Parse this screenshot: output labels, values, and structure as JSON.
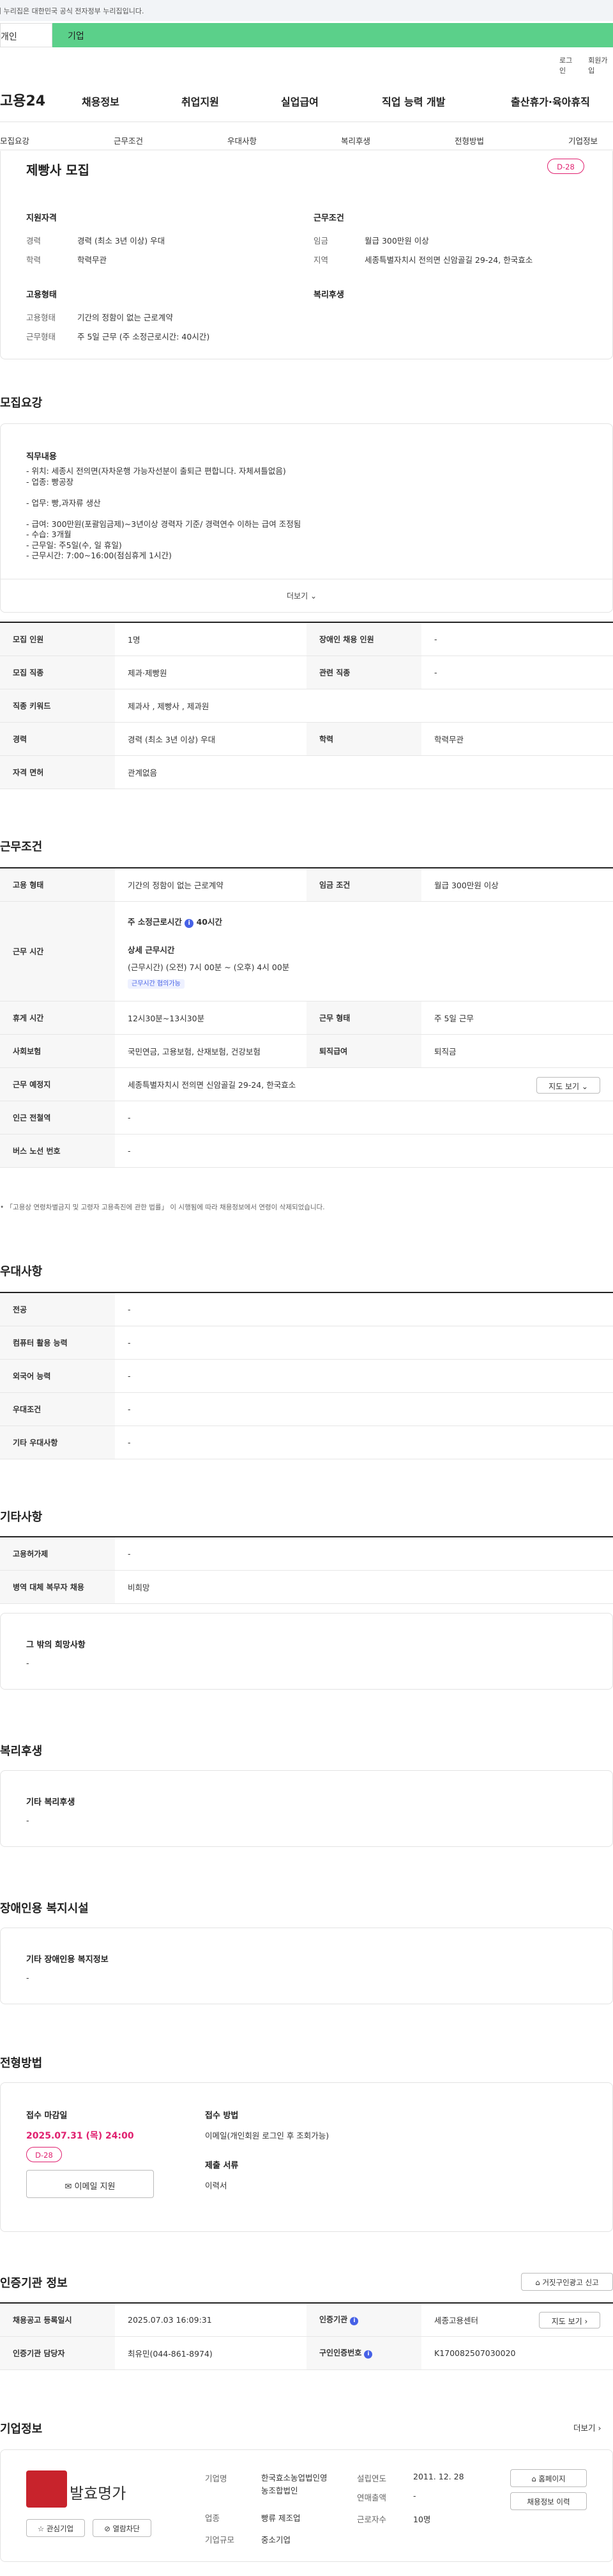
{
  "gov_banner": "이 누리집은 대한민국 공식 전자정부 누리집입니다.",
  "tabs": {
    "person": "개인",
    "corp": "기업"
  },
  "util": {
    "login": "로그인",
    "join": "회원가입"
  },
  "logo": "고용24",
  "gnb": [
    "채용정보",
    "취업지원",
    "실업급여",
    "직업 능력 개발",
    "출산휴가·육아휴직"
  ],
  "subnav": [
    "모집요강",
    "근무조건",
    "우대사항",
    "복리후생",
    "전형방법",
    "기업정보"
  ],
  "summary": {
    "title": "제빵사 모집",
    "dday": "D-28",
    "qual_title": "지원자격",
    "career_label": "경력",
    "career": "경력 (최소 3년 이상) 우대",
    "edu_label": "학력",
    "edu": "학력무관",
    "cond_title": "근무조건",
    "wage_label": "임금",
    "wage": "월급 300만원 이상",
    "region_label": "지역",
    "region": "세종특별자치시 전의면 신암골길 29-24, 한국효소",
    "emp_title": "고용형태",
    "emp_type_label": "고용형태",
    "emp_type": "기간의 정함이 없는 근로계약",
    "work_type_label": "근무형태",
    "work_type": "주 5일 근무 (주 소정근로시간: 40시간)",
    "welfare_title": "복리후생"
  },
  "recruit": {
    "heading": "모집요강",
    "job_title": "직무내용",
    "desc": [
      "- 위치: 세종시 전의면(자차운행 가능자선분이 출퇴근 편합니다. 자체셔틀없음)",
      "- 업종: 빵공장",
      "",
      "- 업무: 빵,과자류 생산",
      "",
      "- 급여: 300만원(포괄임금제)~3년이상 경력자 기준/ 경력연수 이하는 급여 조정됨",
      "- 수습: 3개월",
      "- 근무일: 주5일(수, 일 휴일)",
      "- 근무시간: 7:00~16:00(점심휴게 1시간)"
    ],
    "more": "더보기",
    "rows": [
      [
        "모집 인원",
        "1명",
        "장애인 채용 인원",
        "-"
      ],
      [
        "모집 직종",
        "제과·제빵원",
        "관련 직종",
        "-"
      ],
      [
        "직종 키워드",
        "제과사 , 제빵사 , 제과원",
        "",
        ""
      ],
      [
        "경력",
        "경력 (최소 3년 이상) 우대",
        "학력",
        "학력무관"
      ],
      [
        "자격 면허",
        "관계없음",
        "",
        ""
      ]
    ]
  },
  "work": {
    "heading": "근무조건",
    "r1": [
      "고용 형태",
      "기간의 정함이 없는 근로계약",
      "임금 조건",
      "월급 300만원 이상"
    ],
    "time_label": "근무 시간",
    "weekly": "주 소정근로시간",
    "weekly_val": "40시간",
    "detail_title": "상세 근무시간",
    "detail": "(근무시간) (오전) 7시 00분 ~ (오후) 4시 00분",
    "chip": "근무시간 협의가능",
    "r3": [
      "휴게 시간",
      "12시30분~13시30분",
      "근무 형태",
      "주 5일 근무"
    ],
    "r4": [
      "사회보험",
      "국민연금, 고용보험, 산재보험, 건강보험",
      "퇴직급여",
      "퇴직금"
    ],
    "place_label": "근무 예정지",
    "place": "세종특별자치시 전의면 신암골길 29-24, 한국효소",
    "map_btn": "지도 보기",
    "r6": [
      "인근 전철역",
      "-"
    ],
    "r7": [
      "버스 노선 번호",
      "-"
    ],
    "note": "「고용상 연령차별금지 및 고령자 고용촉진에 관한 법률」 이 시행됨에 따라 채용정보에서 연령이 삭제되었습니다."
  },
  "pref": {
    "heading": "우대사항",
    "rows": [
      [
        "전공",
        "-"
      ],
      [
        "컴퓨터 활용 능력",
        "-"
      ],
      [
        "외국어 능력",
        "-"
      ],
      [
        "우대조건",
        "-"
      ],
      [
        "기타 우대사항",
        "-"
      ]
    ]
  },
  "etc": {
    "heading": "기타사항",
    "rows": [
      [
        "고용허가제",
        "-"
      ],
      [
        "병역 대체 복무자 채용",
        "비희망"
      ]
    ],
    "other_title": "그 밖의 희망사항",
    "other_val": "-"
  },
  "welfare": {
    "heading": "복리후생",
    "title": "기타 복리후생",
    "val": "-"
  },
  "disabled": {
    "heading": "장애인용 복지시설",
    "title": "기타 장애인용 복지정보",
    "val": "-"
  },
  "apply": {
    "heading": "전형방법",
    "deadline_title": "접수 마감일",
    "deadline": "2025.07.31 (목) 24:00",
    "dday": "D-28",
    "email_btn": "이메일 지원",
    "method_title": "접수 방법",
    "method": "이메일(개인회원 로그인 후 조회가능)",
    "docs_title": "제출 서류",
    "docs": "이력서"
  },
  "cert": {
    "heading": "인증기관 정보",
    "report_btn": "거짓구인광고 신고",
    "r1": [
      "채용공고 등록일시",
      "2025.07.03 16:09:31",
      "인증기관",
      "세종고용센터"
    ],
    "map_btn": "지도 보기",
    "r2": [
      "인증기관 담당자",
      "최유민(044-861-8974)",
      "구인인증번호",
      "K170082507030020"
    ]
  },
  "company": {
    "heading": "기업정보",
    "more": "더보기",
    "logo_text": "발효명가",
    "fav_btn": "관심기업",
    "block_btn": "열람차단",
    "name_label": "기업명",
    "name": "한국효소농업법인영농조합법인",
    "industry_label": "업종",
    "industry": "빵류 제조업",
    "scale_label": "기업규모",
    "scale": "중소기업",
    "est_label": "설립연도",
    "est": "2011. 12. 28",
    "sales_label": "연매출액",
    "sales": "-",
    "emp_label": "근로자수",
    "emp": "10명",
    "home_btn": "홈페이지",
    "history_btn": "채용정보 이력"
  },
  "colors": {
    "accent": "#e0206f",
    "brand_green": "#5bd08a",
    "link_blue": "#4661e6"
  }
}
